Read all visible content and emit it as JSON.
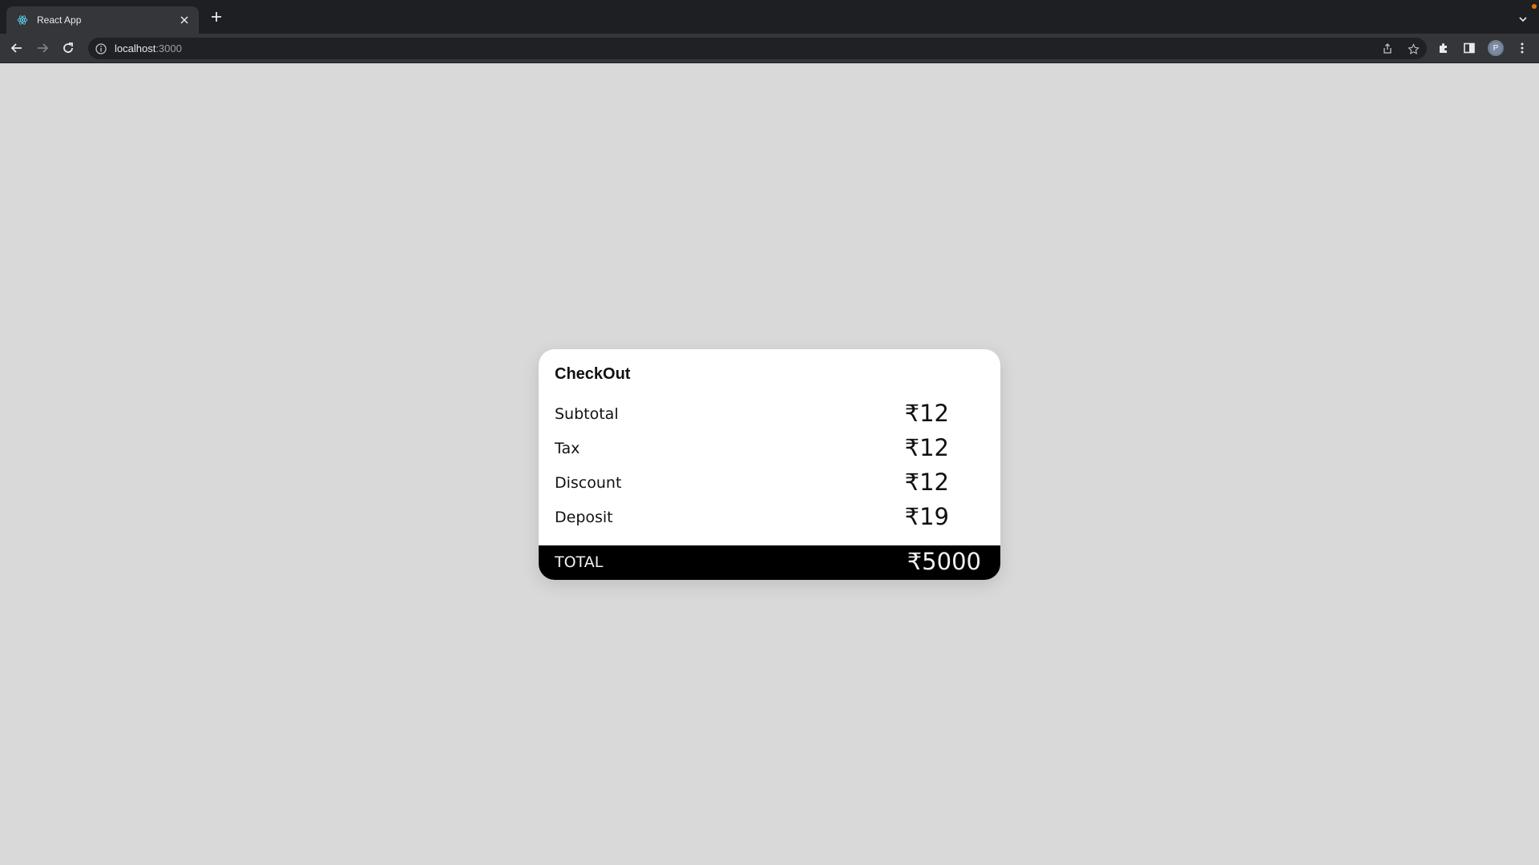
{
  "browser": {
    "tab_title": "React App",
    "url_host": "localhost",
    "url_port": ":3000",
    "avatar_initial": "P",
    "icons": [
      "react-favicon",
      "close-icon",
      "plus-icon",
      "chevron-down-icon",
      "back-icon",
      "forward-icon",
      "reload-icon",
      "info-icon",
      "share-icon",
      "star-icon",
      "extensions-icon",
      "side-panel-icon",
      "more-icon"
    ]
  },
  "checkout": {
    "title": "CheckOut",
    "rows": [
      {
        "label": "Subtotal",
        "value": "₹12"
      },
      {
        "label": "Tax",
        "value": "₹12"
      },
      {
        "label": "Discount",
        "value": "₹12"
      },
      {
        "label": "Deposit",
        "value": "₹19"
      }
    ],
    "total_label": "TOTAL",
    "total_value": "₹5000"
  },
  "colors": {
    "page_background": "#d9d9d9",
    "card_background": "#ffffff",
    "total_bar": "#000000",
    "chrome_dark": "#35363a",
    "notification_dot": "#e37400"
  }
}
